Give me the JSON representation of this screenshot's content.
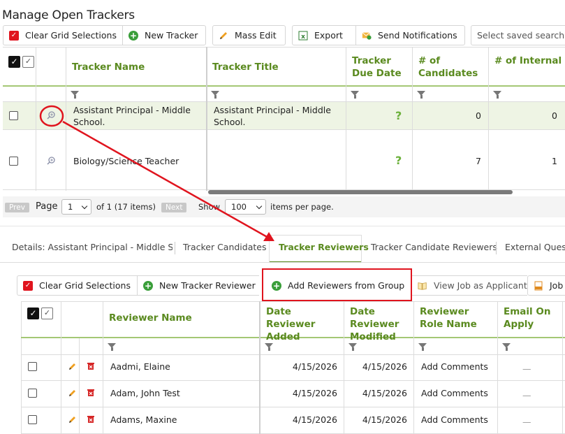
{
  "page": {
    "title": "Manage Open Trackers"
  },
  "toolbar": {
    "clear_grid": "Clear Grid Selections",
    "new_tracker": "New Tracker",
    "mass_edit": "Mass Edit",
    "export": "Export",
    "send_notifications": "Send Notifications",
    "saved_search_placeholder": "Select saved search"
  },
  "trackers_grid": {
    "columns": [
      "Tracker Name",
      "Tracker Title",
      "Tracker Due Date",
      "# of Candidates",
      "# of Internal Candidates"
    ],
    "rows": [
      {
        "name": "Assistant Principal - Middle School.",
        "title": "Assistant Principal - Middle School.",
        "due": "?",
        "candidates": "0",
        "internal": "0"
      },
      {
        "name": "Biology/Science Teacher",
        "title": "",
        "due": "?",
        "candidates": "7",
        "internal": "1"
      }
    ],
    "pager": {
      "prev": "Prev",
      "page_label": "Page",
      "page_value": "1",
      "of_text": "of 1 (17 items)",
      "next": "Next",
      "show_label": "Show",
      "show_value": "100",
      "per_page": "items per page."
    }
  },
  "tabs": [
    {
      "label": "Details: Assistant Principal - Middle S...",
      "active": false
    },
    {
      "label": "Tracker Candidates",
      "active": false
    },
    {
      "label": "Tracker Reviewers",
      "active": true
    },
    {
      "label": "Tracker Candidate Reviewers",
      "active": false
    },
    {
      "label": "External Questi",
      "active": false
    }
  ],
  "reviewers_toolbar": {
    "clear_grid": "Clear Grid Selections",
    "new_reviewer": "New Tracker Reviewer",
    "add_from_group": "Add Reviewers from Group",
    "view_job": "View Job as Applicant",
    "job_pdf": "Job"
  },
  "reviewers_grid": {
    "columns": [
      "Reviewer Name",
      "Date Reviewer Added",
      "Date Reviewer Modified",
      "Reviewer Role Name",
      "Email On Apply"
    ],
    "rows": [
      {
        "name": "Aadmi, Elaine",
        "added": "4/15/2026",
        "modified": "4/15/2026",
        "role": "Add Comments",
        "email": "—"
      },
      {
        "name": "Adam, John Test",
        "added": "4/15/2026",
        "modified": "4/15/2026",
        "role": "Add Comments",
        "email": "—"
      },
      {
        "name": "Adams, Maxine",
        "added": "4/15/2026",
        "modified": "4/15/2026",
        "role": "Add Comments",
        "email": "—"
      }
    ]
  },
  "colors": {
    "accent_green": "#5a8a1f",
    "annotation_red": "#e0141e",
    "selected_row": "#eef4e4"
  }
}
